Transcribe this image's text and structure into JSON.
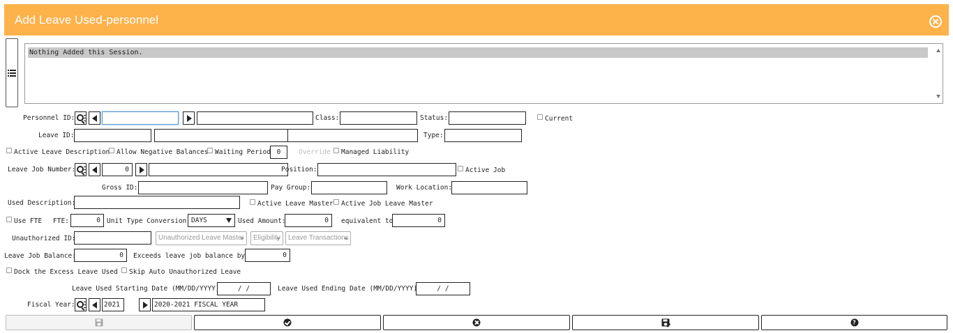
{
  "window": {
    "title": "Add Leave Used-personnel"
  },
  "log": {
    "message": "Nothing Added this Session."
  },
  "form": {
    "personnel_id_label": "Personnel ID:",
    "personnel_id_value": "",
    "personnel_name_value": "",
    "class_label": "Class:",
    "class_value": "",
    "status_label": "Status:",
    "status_value": "",
    "current_label": "Current",
    "leave_id_label": "Leave ID:",
    "leave_id_value": "",
    "leave_desc_value": "",
    "leave_desc2_value": "",
    "type_label": "Type:",
    "type_value": "",
    "active_leave_desc_label": "Active Leave Description",
    "allow_negative_label": "Allow Negative Balances",
    "waiting_period_label": "Waiting Period",
    "waiting_period_value": "0",
    "override_label": "Override",
    "managed_liability_label": "Managed Liability",
    "leave_job_number_label": "Leave Job Number:",
    "leave_job_number_value": "0",
    "position_label": "Position:",
    "position_value": "",
    "active_job_label": "Active Job",
    "gross_id_label": "Gross ID:",
    "gross_id_value": "",
    "pay_group_label": "Pay Group:",
    "pay_group_value": "",
    "work_location_label": "Work Location:",
    "work_location_value": "",
    "used_description_label": "Used Description:",
    "used_description_value": "",
    "active_leave_master_label": "Active Leave Master",
    "active_job_leave_master_label": "Active Job Leave Master",
    "use_fte_label": "Use FTE",
    "fte_label": "FTE:",
    "fte_value": "0",
    "unit_type_label": "Unit Type Conversion:",
    "unit_type_value": "DAYS",
    "used_amount_label": "Used Amount:",
    "used_amount_value": "0",
    "equivalent_label": "equivalent to",
    "equivalent_value": "0",
    "unauthorized_id_label": "Unauthorized ID:",
    "unauthorized_id_value": "",
    "unauth_leave_master_btn": "Unauthorized Leave Master",
    "eligibility_btn": "Eligibility",
    "leave_transactions_btn": "Leave Transactions",
    "leave_job_balance_label": "Leave Job Balance:",
    "leave_job_balance_value": "0",
    "exceeds_label": "Exceeds leave job balance by:",
    "exceeds_value": "0",
    "dock_excess_label": "Dock the Excess Leave Used",
    "skip_auto_label": "Skip Auto Unauthorized Leave",
    "start_date_label": "Leave Used Starting Date (MM/DD/YYYY):",
    "start_date_value": "/  /",
    "end_date_label": "Leave Used Ending Date (MM/DD/YYYY):",
    "end_date_value": "/  /",
    "fiscal_year_label": "Fiscal Year:",
    "fiscal_year_value": "2021",
    "fiscal_year_desc": "2020-2021 FISCAL YEAR"
  },
  "colors": {
    "header": "#fdb24a",
    "focus": "#5b9bd5"
  },
  "icons": [
    "close-icon",
    "list-icon",
    "search-icon",
    "prev-arrow-icon",
    "next-arrow-icon",
    "save-icon",
    "check-circle-icon",
    "x-circle-icon",
    "save-check-icon",
    "question-circle-icon"
  ]
}
